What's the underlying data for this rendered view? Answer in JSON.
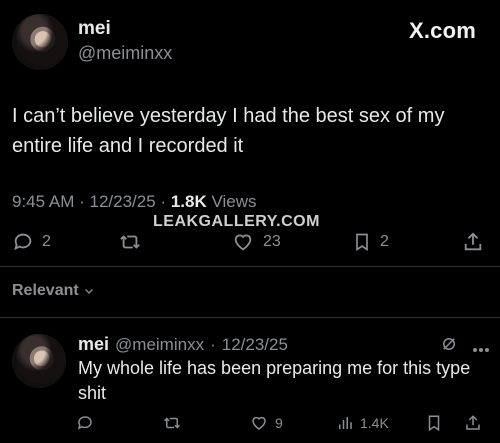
{
  "tweet": {
    "author_name": "mei",
    "author_handle": "@meiminxx",
    "brand": "X.com",
    "text": "I can’t believe yesterday I had the best sex of my entire life and I recorded it",
    "time": "9:45 AM",
    "date": "12/23/25",
    "views_count": "1.8K",
    "views_label": "Views",
    "watermark": "LEAKGALLERY.COM",
    "actions": {
      "replies": "2",
      "retweets": "",
      "likes": "23",
      "bookmarks": "2"
    },
    "icons": [
      "reply-icon",
      "retweet-icon",
      "like-icon",
      "bookmark-icon",
      "share-icon"
    ]
  },
  "sort": {
    "label": "Relevant"
  },
  "reply": {
    "author_name": "mei",
    "author_handle": "@meiminxx",
    "date": "12/23/25",
    "text": "My whole life has been preparing me for this type shit",
    "actions": {
      "replies": "",
      "retweets": "",
      "likes": "9",
      "views": "1.4K"
    }
  },
  "colors": {
    "background": "#000000",
    "text": "#e7e9ea",
    "muted": "#8b8f94",
    "divider": "#2f3336"
  }
}
